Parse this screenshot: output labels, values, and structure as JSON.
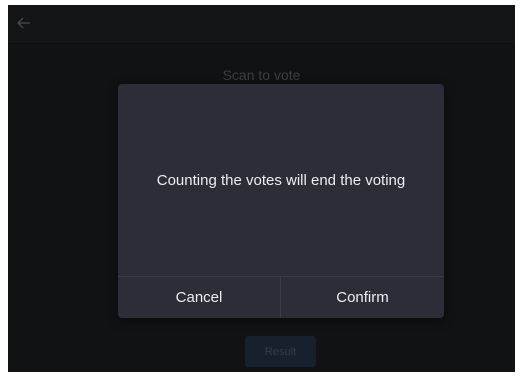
{
  "header": {
    "back_icon": "arrow-left-icon"
  },
  "page": {
    "title": "Scan to vote",
    "qr_icon": "qr-code-icon",
    "result_label": "Result"
  },
  "dialog": {
    "message": "Counting the votes will end the voting",
    "cancel_label": "Cancel",
    "confirm_label": "Confirm"
  },
  "colors": {
    "background": "#1b1c20",
    "dialog_bg": "#2c2d37",
    "text": "#eceef2",
    "result_button_bg": "#223247"
  }
}
